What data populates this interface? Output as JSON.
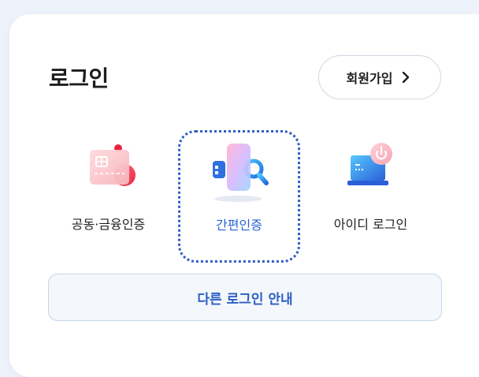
{
  "login": {
    "title": "로그인",
    "signup_label": "회원가입",
    "options": [
      {
        "label": "공동·금융인증",
        "icon": "certificate-card-icon",
        "selected": false
      },
      {
        "label": "간편인증",
        "icon": "phone-search-icon",
        "selected": true
      },
      {
        "label": "아이디 로그인",
        "icon": "laptop-power-icon",
        "selected": false
      }
    ],
    "guide_label": "다른 로그인 안내"
  },
  "colors": {
    "accent": "#2f5ec6",
    "selected_text": "#2b63d4",
    "guide_bg": "#f4f7fc"
  }
}
